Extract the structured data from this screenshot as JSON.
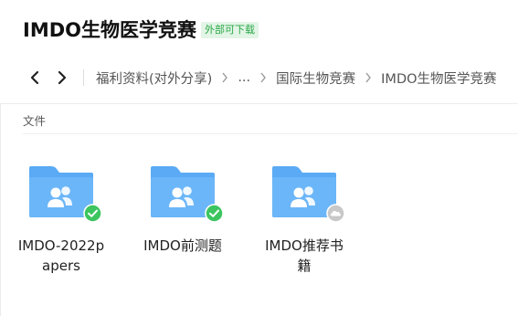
{
  "header": {
    "title": "IMDO生物医学竞赛",
    "badge": "外部可下载"
  },
  "nav": {
    "back_icon": "chevron-left-icon",
    "forward_icon": "chevron-right-icon"
  },
  "breadcrumb": {
    "items": [
      "福利资料(对外分享)",
      "...",
      "国际生物竞赛",
      "IMDO生物医学竞赛"
    ]
  },
  "section": {
    "label": "文件"
  },
  "files": [
    {
      "name": "IMDO-2022papers",
      "icon": "shared-folder-icon",
      "status": "synced-check-icon"
    },
    {
      "name": "IMDO前测题",
      "icon": "shared-folder-icon",
      "status": "synced-check-icon"
    },
    {
      "name": "IMDO推荐书籍",
      "icon": "shared-folder-icon",
      "status": "cloud-icon"
    }
  ],
  "colors": {
    "folder_blue": "#5aaaf5",
    "folder_tab": "#4e9ef0",
    "check_green": "#3cc55f",
    "cloud_gray": "#c8c8c8",
    "badge_bg": "#e3f5e6",
    "badge_text": "#28a745"
  }
}
